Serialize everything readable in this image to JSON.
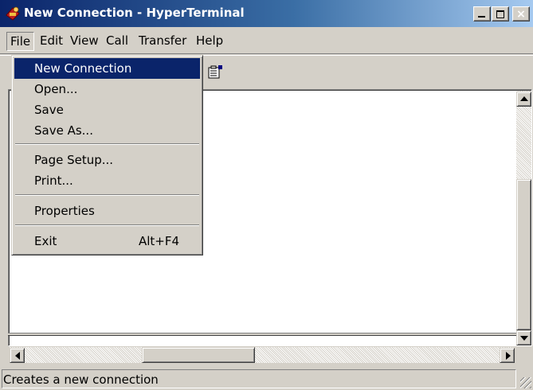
{
  "window": {
    "title": "New Connection - HyperTerminal",
    "icon": "hyperterminal-phone-icon"
  },
  "caption_buttons": {
    "minimize": "minimize-icon",
    "maximize": "maximize-icon",
    "close": "×"
  },
  "menubar": {
    "items": [
      {
        "label": "File"
      },
      {
        "label": "Edit"
      },
      {
        "label": "View"
      },
      {
        "label": "Call"
      },
      {
        "label": "Transfer"
      },
      {
        "label": "Help"
      }
    ]
  },
  "toolbar": {
    "properties_icon": "properties-icon"
  },
  "file_menu": {
    "items": [
      {
        "label": "New Connection",
        "selected": true
      },
      {
        "label": "Open..."
      },
      {
        "label": "Save"
      },
      {
        "label": "Save As..."
      },
      {
        "label": "Page Setup..."
      },
      {
        "label": "Print..."
      },
      {
        "label": "Properties"
      },
      {
        "label": "Exit",
        "shortcut": "Alt+F4"
      }
    ]
  },
  "statusbar": {
    "text": "Creates a new connection"
  },
  "colors": {
    "title_start": "#0a246a",
    "title_end": "#a6caf0",
    "selection": "#0a246a",
    "face": "#d4d0c8"
  }
}
